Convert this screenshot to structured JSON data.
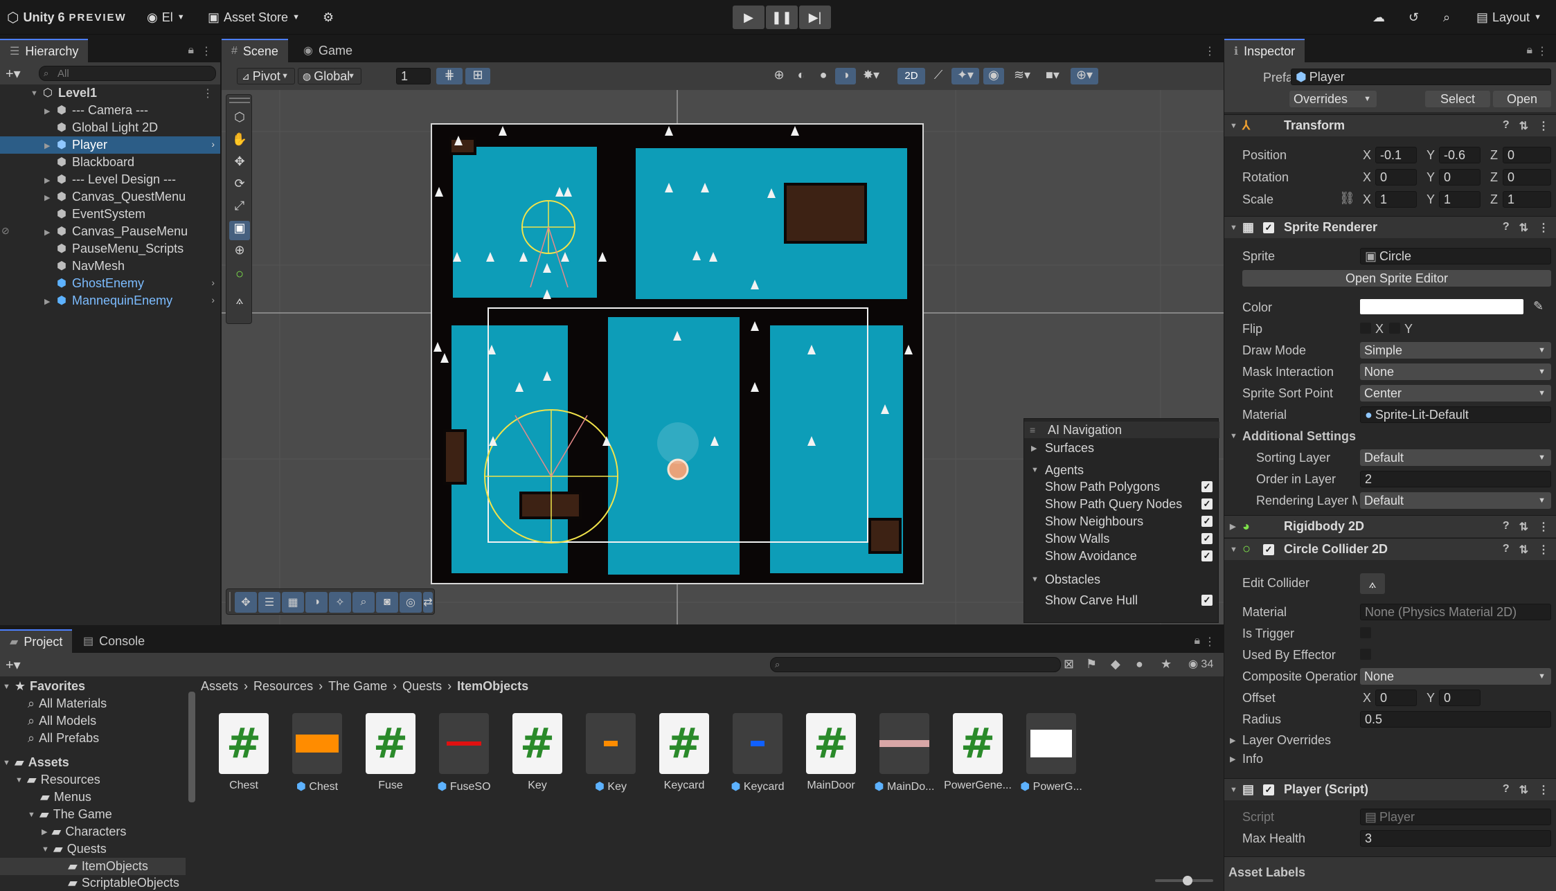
{
  "toolbar": {
    "app_title": "Unity 6",
    "preview_label": "PREVIEW",
    "account": "El",
    "asset_store": "Asset Store",
    "layout": "Layout"
  },
  "hierarchy": {
    "tab": "Hierarchy",
    "search_placeholder": "All",
    "scene": "Level1",
    "items": [
      {
        "label": "--- Camera ---"
      },
      {
        "label": "Global Light 2D"
      },
      {
        "label": "Player"
      },
      {
        "label": "Blackboard"
      },
      {
        "label": "--- Level Design ---"
      },
      {
        "label": "Canvas_QuestMenu"
      },
      {
        "label": "EventSystem"
      },
      {
        "label": "Canvas_PauseMenu"
      },
      {
        "label": "PauseMenu_Scripts"
      },
      {
        "label": "NavMesh"
      },
      {
        "label": "GhostEnemy"
      },
      {
        "label": "MannequinEnemy"
      }
    ]
  },
  "scene": {
    "tab_scene": "Scene",
    "tab_game": "Game",
    "pivot": "Pivot",
    "global": "Global",
    "grid_size": "1",
    "mode_2d": "2D"
  },
  "ai_navigation": {
    "title": "AI Navigation",
    "surfaces": "Surfaces",
    "agents": "Agents",
    "agent_options": [
      {
        "label": "Show Path Polygons"
      },
      {
        "label": "Show Path Query Nodes"
      },
      {
        "label": "Show Neighbours"
      },
      {
        "label": "Show Walls"
      },
      {
        "label": "Show Avoidance"
      }
    ],
    "obstacles": "Obstacles",
    "obstacle_options": [
      {
        "label": "Show Carve Hull"
      }
    ]
  },
  "inspector": {
    "tab": "Inspector",
    "prefab_label": "Prefab",
    "prefab_name": "Player",
    "overrides": "Overrides",
    "select": "Select",
    "open": "Open",
    "transform": {
      "title": "Transform",
      "position_label": "Position",
      "rotation_label": "Rotation",
      "scale_label": "Scale",
      "position": {
        "x": "-0.1",
        "y": "-0.6",
        "z": "0"
      },
      "rotation": {
        "x": "0",
        "y": "0",
        "z": "0"
      },
      "scale": {
        "x": "1",
        "y": "1",
        "z": "1"
      }
    },
    "sprite_renderer": {
      "title": "Sprite Renderer",
      "sprite_label": "Sprite",
      "sprite": "Circle",
      "open_editor": "Open Sprite Editor",
      "color_label": "Color",
      "flip_label": "Flip",
      "flip_x": "X",
      "flip_y": "Y",
      "draw_mode_label": "Draw Mode",
      "draw_mode": "Simple",
      "mask_label": "Mask Interaction",
      "mask": "None",
      "sort_point_label": "Sprite Sort Point",
      "sort_point": "Center",
      "material_label": "Material",
      "material": "Sprite-Lit-Default",
      "additional": "Additional Settings",
      "sorting_layer_label": "Sorting Layer",
      "sorting_layer": "Default",
      "order_label": "Order in Layer",
      "order": "2",
      "rendering_layer_label": "Rendering Layer M",
      "rendering_layer": "Default"
    },
    "rigidbody": {
      "title": "Rigidbody 2D"
    },
    "circle_collider": {
      "title": "Circle Collider 2D",
      "edit_label": "Edit Collider",
      "material_label": "Material",
      "material": "None (Physics Material 2D)",
      "trigger_label": "Is Trigger",
      "effector_label": "Used By Effector",
      "composite_label": "Composite Operatior",
      "composite": "None",
      "offset_label": "Offset",
      "offset": {
        "x": "0",
        "y": "0"
      },
      "radius_label": "Radius",
      "radius": "0.5",
      "layer_overrides": "Layer Overrides",
      "info": "Info"
    },
    "player_script": {
      "title": "Player (Script)",
      "script_label": "Script",
      "script": "Player",
      "health_label": "Max Health",
      "health": "3"
    },
    "asset_labels": "Asset Labels"
  },
  "project": {
    "tab_project": "Project",
    "tab_console": "Console",
    "hidden_count": "34",
    "favorites": "Favorites",
    "favorite_items": [
      {
        "label": "All Materials"
      },
      {
        "label": "All Models"
      },
      {
        "label": "All Prefabs"
      }
    ],
    "assets": "Assets",
    "resources": "Resources",
    "menus": "Menus",
    "the_game": "The Game",
    "characters": "Characters",
    "quests": "Quests",
    "item_objects": "ItemObjects",
    "scriptable_objects": "ScriptableObjects",
    "breadcrumb": [
      {
        "label": "Assets"
      },
      {
        "label": "Resources"
      },
      {
        "label": "The Game"
      },
      {
        "label": "Quests"
      },
      {
        "label": "ItemObjects"
      }
    ],
    "files": [
      {
        "name": "Chest",
        "kind": "script"
      },
      {
        "name": "Chest",
        "kind": "prefab",
        "color": "#ff8c00"
      },
      {
        "name": "Fuse",
        "kind": "script"
      },
      {
        "name": "FuseSO",
        "kind": "prefab",
        "color": "#e01010"
      },
      {
        "name": "Key",
        "kind": "script"
      },
      {
        "name": "Key",
        "kind": "prefab",
        "color": "#ff8c00"
      },
      {
        "name": "Keycard",
        "kind": "script"
      },
      {
        "name": "Keycard",
        "kind": "prefab",
        "color": "#1060ff"
      },
      {
        "name": "MainDoor",
        "kind": "script"
      },
      {
        "name": "MainDo...",
        "kind": "prefab",
        "color": "#d8a6a6"
      },
      {
        "name": "PowerGene...",
        "kind": "script"
      },
      {
        "name": "PowerG...",
        "kind": "prefab",
        "color": "#ffffff"
      }
    ]
  },
  "colors": {
    "accent": "#4c7fff",
    "selection": "#2c5d87",
    "navmesh": "#0d9db8",
    "prefab_blue": "#5db2ff"
  }
}
